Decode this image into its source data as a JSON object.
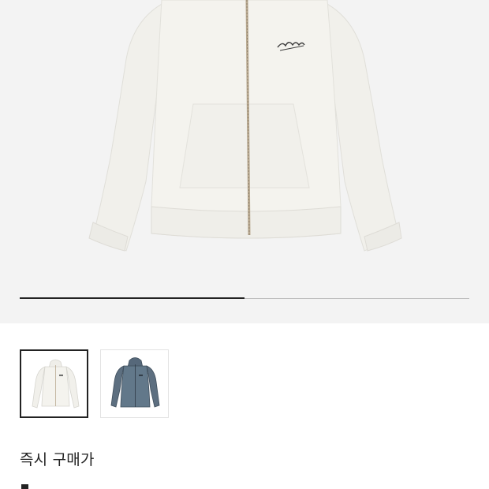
{
  "gallery": {
    "main_image": "white-zip-hoodie",
    "progress_fraction": 0.5,
    "thumbnails": [
      {
        "image": "white-zip-hoodie",
        "selected": true
      },
      {
        "image": "blue-grey-zip-hoodie",
        "selected": false
      }
    ]
  },
  "section": {
    "title": "즉시 구매가"
  },
  "colors": {
    "hero_background": "#f3f3f3",
    "hoodie_white": "#f4f3ee",
    "hoodie_blue_grey": "#5d6f80",
    "accent_dark": "#222222"
  }
}
